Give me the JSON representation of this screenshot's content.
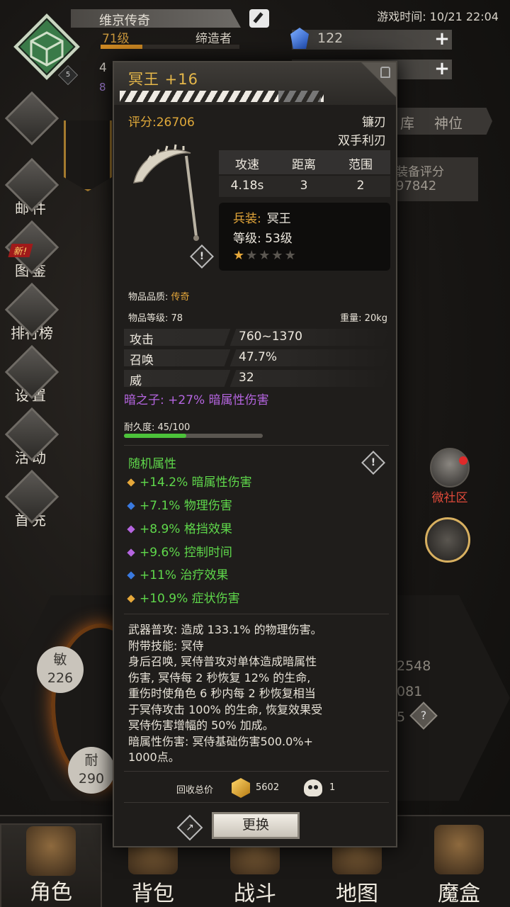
{
  "top_bar": {
    "player_name": "维京传奇",
    "level": "71级",
    "title": "缔造者",
    "avatar_level": "5",
    "gems": "122",
    "game_time": "游戏时间: 10/21 22:04",
    "partial_num": "4",
    "partial_num2": "8"
  },
  "side_menu": {
    "items": [
      {
        "label": ""
      },
      {
        "label": "邮件"
      },
      {
        "label": "图鉴"
      },
      {
        "label": "排行榜"
      },
      {
        "label": "设置"
      },
      {
        "label": "活动"
      },
      {
        "label": "首充"
      }
    ],
    "new_tag": "新!"
  },
  "right_panel": {
    "tab1": "库",
    "tab2": "神位",
    "equip_score_label": "装备评分",
    "equip_score_value": "97842",
    "community_label": "微社区"
  },
  "stats": {
    "agi_label": "敏",
    "agi_value": "226",
    "end_label": "耐",
    "end_value": "290",
    "right1": "2548",
    "right2": "081",
    "right3": "5"
  },
  "bottom_nav": [
    {
      "label": "角色",
      "active": true
    },
    {
      "label": "背包",
      "active": false
    },
    {
      "label": "战斗",
      "active": false
    },
    {
      "label": "地图",
      "active": false
    },
    {
      "label": "魔盒",
      "active": false
    }
  ],
  "item": {
    "name": "冥王 +16",
    "score": "评分:26706",
    "type1": "镰刃",
    "type2": "双手利刃",
    "spec_headers": [
      "攻速",
      "距离",
      "范围"
    ],
    "spec_values": [
      "4.18s",
      "3",
      "2"
    ],
    "soldier_key": "兵装:",
    "soldier_value": "冥王",
    "soldier_level": "等级: 53级",
    "stars_on": 1,
    "stars_total": 5,
    "quality_label": "物品品质: ",
    "quality_value": "传奇",
    "item_level": "物品等级: 78",
    "weight": "重量: 20kg",
    "base_attrs": [
      {
        "key": "攻击",
        "value": "760~1370"
      },
      {
        "key": "召唤",
        "value": "47.7%"
      },
      {
        "key": "威",
        "value": "32"
      }
    ],
    "dark_bonus": "暗之子: +27% 暗属性伤害",
    "durability_label": "耐久度: 45/100",
    "durability_fraction": 0.45,
    "random_title": "随机属性",
    "random_attrs": [
      {
        "text": "+14.2% 暗属性伤害",
        "color": "#e6a83a"
      },
      {
        "text": "+7.1% 物理伤害",
        "color": "#3a7ae0"
      },
      {
        "text": "+8.9% 格挡效果",
        "color": "#b565e0"
      },
      {
        "text": "+9.6% 控制时间",
        "color": "#b565e0"
      },
      {
        "text": "+11% 治疗效果",
        "color": "#3a7ae0"
      },
      {
        "text": "+10.9% 症状伤害",
        "color": "#e6a83a"
      }
    ],
    "description": "武器普攻: 造成 133.1% 的物理伤害。\n附带技能: 冥侍\n身后召唤, 冥侍普攻对单体造成暗属性\n伤害, 冥侍每 2 秒恢复 12% 的生命,\n重伤时使角色 6 秒内每 2 秒恢复相当\n于冥侍攻击 100% 的生命, 恢复效果受\n冥侍伤害增幅的 50% 加成。\n暗属性伤害: 冥侍基础伤害500.0%+\n1000点。",
    "recycle_label": "回收总价",
    "recycle_gold": "5602",
    "recycle_skull": "1",
    "swap_button": "更换"
  },
  "colors": {
    "legendary": "#e6b84a",
    "green": "#5fd84b",
    "purple": "#b565e0"
  }
}
